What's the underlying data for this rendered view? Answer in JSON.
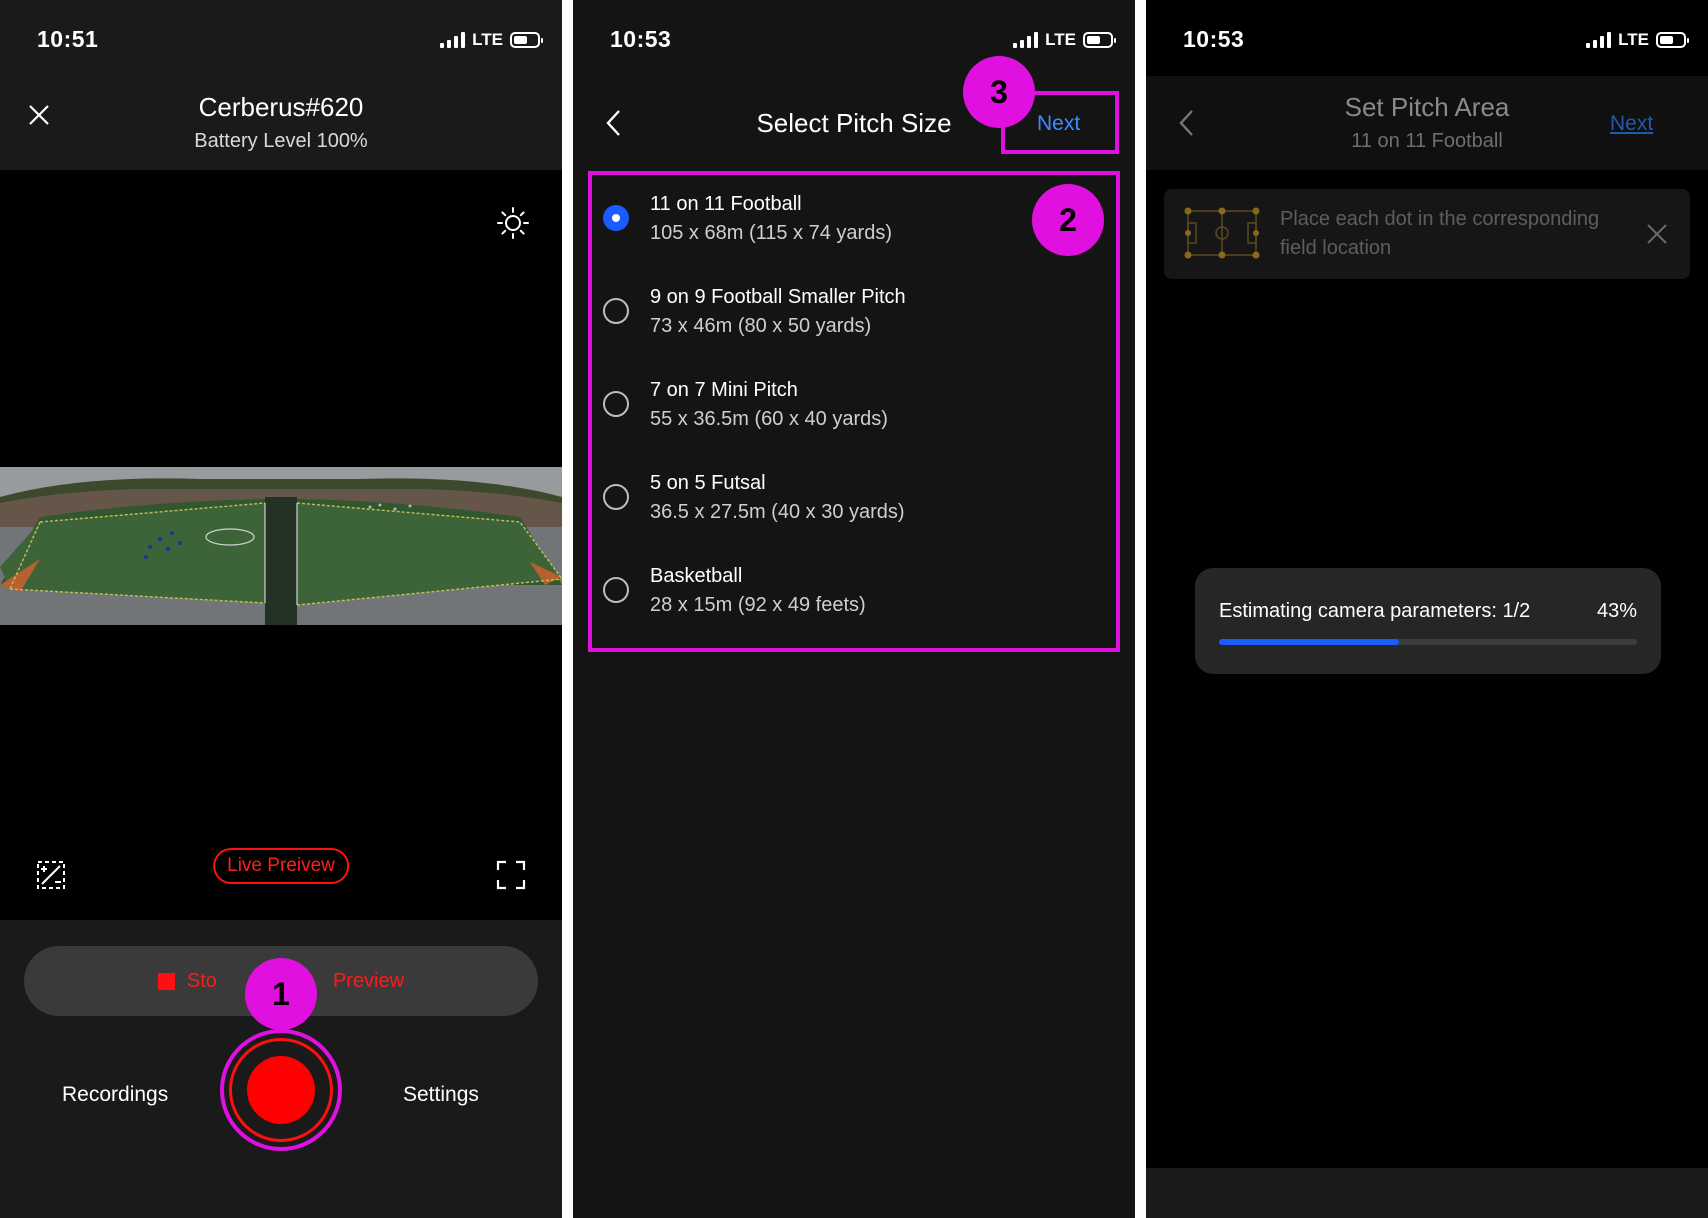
{
  "screen1": {
    "status": {
      "time": "10:51",
      "network": "LTE"
    },
    "header": {
      "title": "Cerberus#620",
      "subtitle": "Battery Level 100%"
    },
    "icons": {
      "close": "close-icon",
      "brightness": "brightness-icon",
      "edit": "edit-pitch-icon",
      "fullscreen": "fullscreen-icon"
    },
    "live_badge": "Live Preivew",
    "stop_button": {
      "label_left": "Sto",
      "label_right": "Preview"
    },
    "nav": {
      "recordings": "Recordings",
      "settings": "Settings"
    },
    "callout": "1",
    "colors": {
      "record_red": "#ff0000",
      "annotation_magenta": "#e010e0"
    }
  },
  "screen2": {
    "status": {
      "time": "10:53",
      "network": "LTE"
    },
    "header": {
      "title": "Select Pitch Size",
      "next": "Next"
    },
    "pitch_sizes": [
      {
        "name": "11 on 11 Football",
        "dims": "105 x 68m (115 x 74 yards)",
        "selected": true
      },
      {
        "name": "9 on 9 Football Smaller Pitch",
        "dims": "73 x 46m (80 x 50 yards)",
        "selected": false
      },
      {
        "name": "7 on 7 Mini Pitch",
        "dims": "55 x 36.5m (60 x 40 yards)",
        "selected": false
      },
      {
        "name": "5 on 5 Futsal",
        "dims": "36.5 x 27.5m (40 x 30 yards)",
        "selected": false
      },
      {
        "name": "Basketball",
        "dims": "28 x 15m (92 x 49 feets)",
        "selected": false
      }
    ],
    "callouts": {
      "list": "2",
      "next": "3"
    },
    "colors": {
      "accent_blue": "#3d8bff",
      "radio_selected": "#1a5cff"
    }
  },
  "screen3": {
    "status": {
      "time": "10:53",
      "network": "LTE"
    },
    "header": {
      "title": "Set Pitch Area",
      "subtitle": "11 on 11 Football",
      "next": "Next"
    },
    "tip": {
      "text": "Place each dot in the corresponding field location"
    },
    "progress": {
      "label": "Estimating camera parameters: 1/2",
      "percent_text": "43%",
      "value": 0.43
    }
  }
}
